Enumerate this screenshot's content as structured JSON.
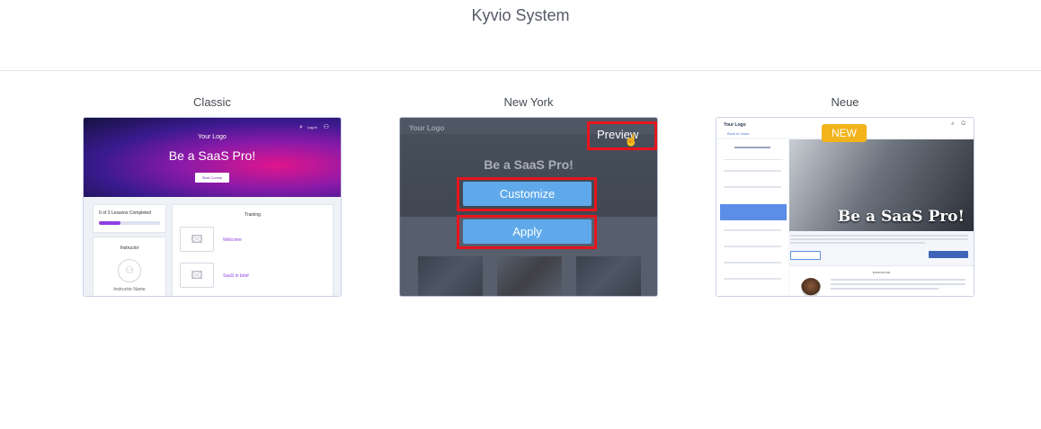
{
  "page": {
    "title": "Kyvio System"
  },
  "themes": [
    {
      "label": "Classic",
      "preview": {
        "logo": "Your Logo",
        "headline": "Be a SaaS Pro!",
        "cta": "Start Course",
        "login": "Log in",
        "progress_label": "0 of 3 Lessons Completed",
        "progress_value": 0.35,
        "training_heading": "Training",
        "instructor_heading": "Instructor",
        "instructor_name": "Instructor Name",
        "lessons": [
          "Welcome",
          "SaaS in brief"
        ]
      }
    },
    {
      "label": "New York",
      "preview": {
        "logo": "Your Logo",
        "headline": "Be a SaaS Pro!"
      },
      "actions": {
        "preview": "Preview",
        "customize": "Customize",
        "apply": "Apply"
      }
    },
    {
      "label": "Neue",
      "badge": "NEW",
      "preview": {
        "logo": "Your Logo",
        "back_link": "Back to home",
        "headline": "Be a SaaS Pro!",
        "instructor_heading": "INSTRUCTOR"
      }
    }
  ],
  "colors": {
    "accent_blue": "#5fa9ea",
    "highlight_red": "#e8141c",
    "badge_orange": "#f3b31a"
  }
}
